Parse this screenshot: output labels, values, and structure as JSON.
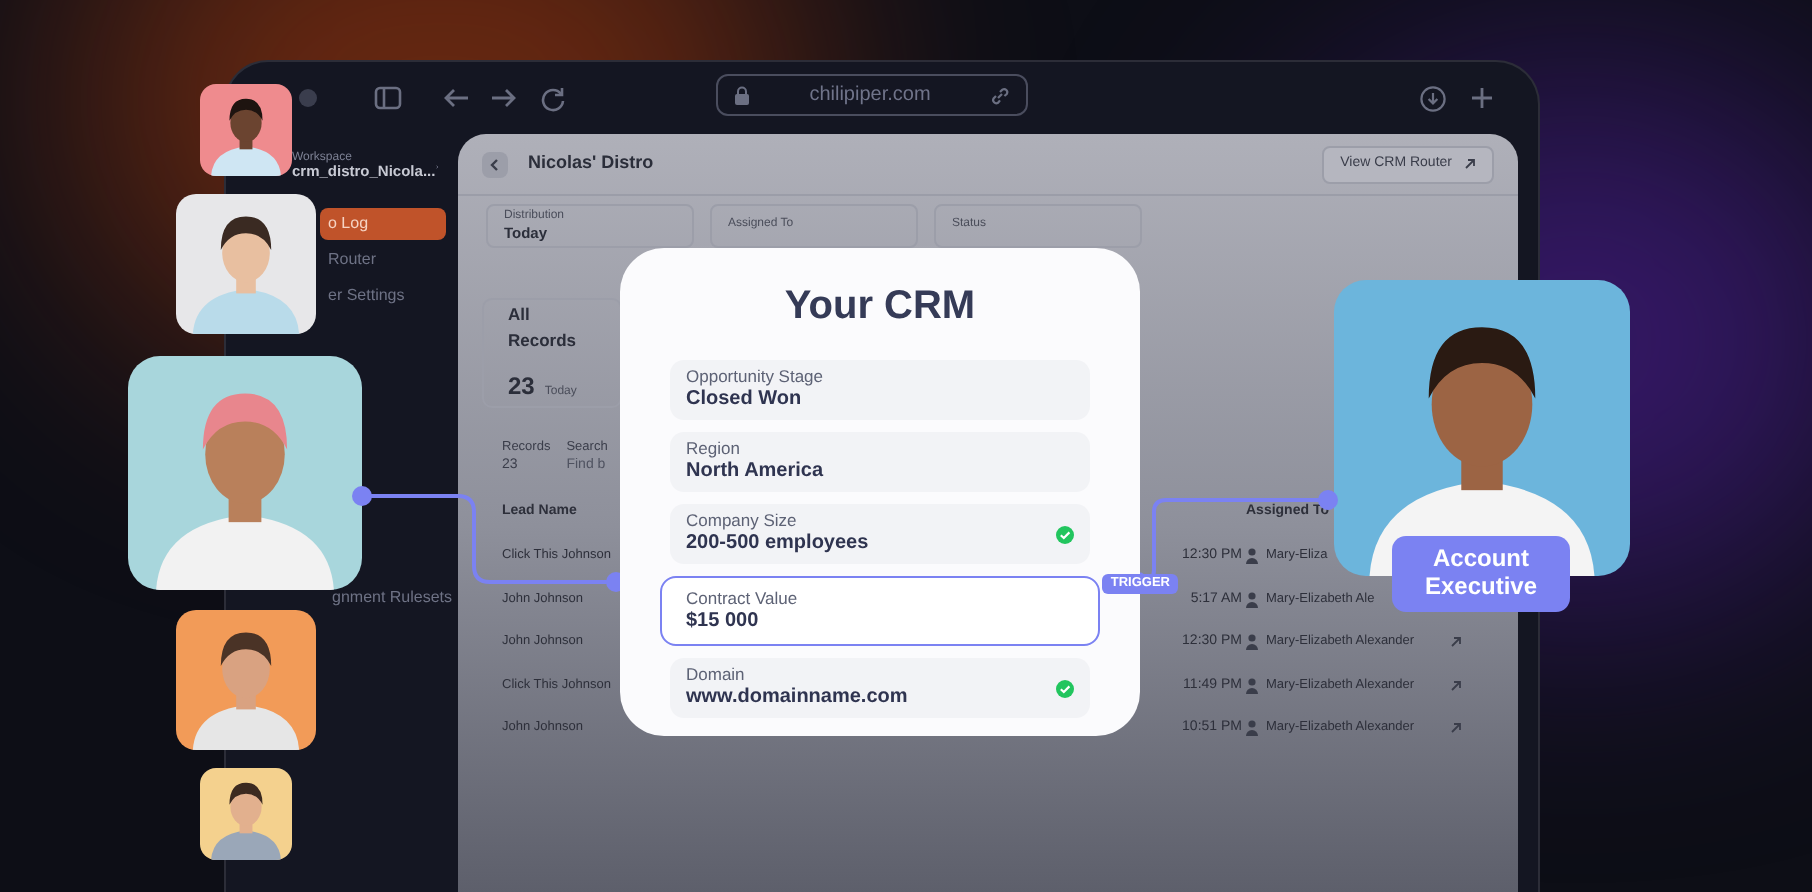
{
  "browser": {
    "url": "chilipiper.com"
  },
  "sidebar": {
    "workspace_label": "Workspace",
    "workspace_name": "crm_distro_Nicola...",
    "items": [
      {
        "label": "o Log",
        "selected": true
      },
      {
        "label": "Router",
        "selected": false
      },
      {
        "label": "er Settings",
        "selected": false
      },
      {
        "label": "gnment Rulesets",
        "selected": false
      }
    ]
  },
  "page": {
    "title": "Nicolas' Distro",
    "action": "View CRM Router",
    "filters": [
      {
        "label": "Distribution",
        "value": "Today"
      },
      {
        "label": "Assigned To"
      },
      {
        "label": "Status"
      }
    ],
    "records_card": {
      "title": "All Records",
      "count": "23",
      "period": "Today"
    },
    "records": {
      "label": "Records",
      "count": "23",
      "search_label": "Search",
      "search_placeholder": "Find b"
    },
    "table": {
      "columns": [
        "Lead Name",
        "Assigned To"
      ],
      "rows": [
        {
          "lead": "Click This Johnson",
          "time": "12:30 PM",
          "assignee": "Mary-Eliza"
        },
        {
          "lead": "John Johnson",
          "time": "5:17 AM",
          "assignee": "Mary-Elizabeth Ale"
        },
        {
          "lead": "John Johnson",
          "time": "12:30 PM",
          "assignee": "Mary-Elizabeth Alexander"
        },
        {
          "lead": "Click This Johnson",
          "time": "11:49 PM",
          "assignee": "Mary-Elizabeth Alexander"
        },
        {
          "lead": "John Johnson",
          "time": "10:51 PM",
          "assignee": "Mary-Elizabeth Alexander"
        }
      ]
    }
  },
  "crm_card": {
    "title": "Your CRM",
    "badge": "TRIGGER",
    "fields": [
      {
        "label": "Opportunity Stage",
        "value": "Closed Won",
        "checked": false,
        "selected": false
      },
      {
        "label": "Region",
        "value": "North America",
        "checked": false,
        "selected": false
      },
      {
        "label": "Company Size",
        "value": "200-500 employees",
        "checked": true,
        "selected": false
      },
      {
        "label": "Contract Value",
        "value": "$15 000",
        "checked": false,
        "selected": true
      },
      {
        "label": "Domain",
        "value": "www.domainname.com",
        "checked": true,
        "selected": false
      }
    ]
  },
  "role_badge": "Account Executive"
}
